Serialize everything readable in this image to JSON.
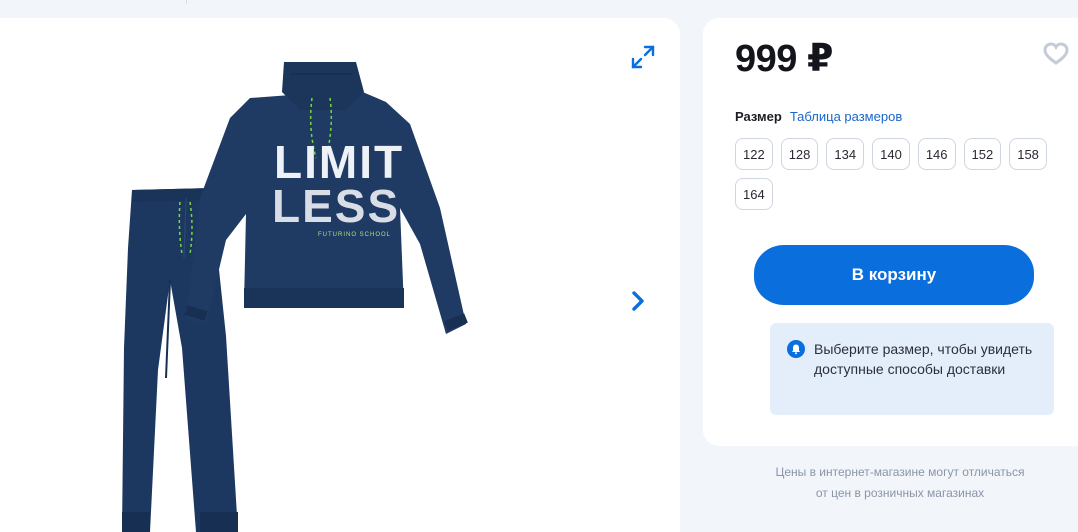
{
  "gallery": {
    "image_alt": "Спортивный костюм",
    "print_line1": "LIMIT",
    "print_line2": "LESS",
    "print_brand": "FUTURINO SCHOOL",
    "icons": {
      "expand": "expand-arrows-icon",
      "next": "chevron-right-icon"
    }
  },
  "buy": {
    "price": "999 ₽",
    "favorite_icon": "heart-icon",
    "size_label": "Размер",
    "size_table_link": "Таблица размеров",
    "sizes": [
      "122",
      "128",
      "134",
      "140",
      "146",
      "152",
      "158",
      "164"
    ],
    "cart_button": "В корзину",
    "note_icon": "bell-icon",
    "delivery_note": "Выберите размер, чтобы увидеть доступные способы доставки"
  },
  "disclaimer": {
    "line1": "Цены в интернет-магазине могут отличаться",
    "line2": "от цен в розничных магазинах"
  },
  "colors": {
    "accent": "#0a6fdc",
    "garment": "#1f3a63",
    "note_bg": "#e4eefb",
    "page_bg": "#f2f5f9"
  }
}
